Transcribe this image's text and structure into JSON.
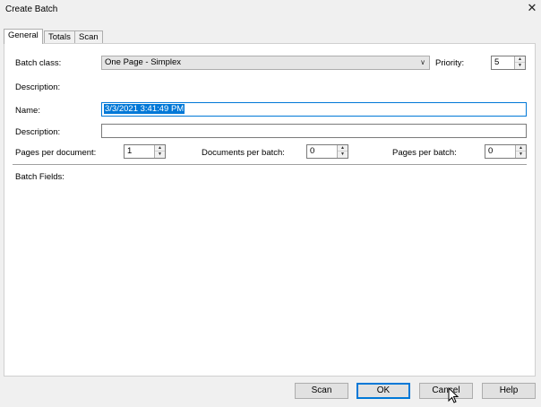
{
  "window": {
    "title": "Create Batch",
    "close_glyph": "✕"
  },
  "tabs": [
    {
      "label": "General",
      "active": true
    },
    {
      "label": "Totals",
      "active": false
    },
    {
      "label": "Scan",
      "active": false
    }
  ],
  "general": {
    "batch_class_label": "Batch class:",
    "batch_class_value": "One Page - Simplex",
    "priority_label": "Priority:",
    "priority_value": "5",
    "description_static_label": "Description:",
    "name_label": "Name:",
    "name_value": "3/3/2021 3:41:49 PM",
    "description_label": "Description:",
    "description_value": "",
    "pages_per_document_label": "Pages per document:",
    "pages_per_document_value": "1",
    "documents_per_batch_label": "Documents per batch:",
    "documents_per_batch_value": "0",
    "pages_per_batch_label": "Pages per batch:",
    "pages_per_batch_value": "0",
    "batch_fields_label": "Batch Fields:"
  },
  "buttons": {
    "scan": "Scan",
    "ok": "OK",
    "cancel": "Cancel",
    "help": "Help"
  },
  "icons": {
    "close": "close-icon",
    "dropdown": "chevron-down-icon",
    "spin_up": "arrow-up-icon",
    "spin_down": "arrow-down-icon",
    "cursor": "mouse-pointer-icon"
  },
  "colors": {
    "selection": "#0078d7",
    "focus_border": "#0078d7"
  }
}
